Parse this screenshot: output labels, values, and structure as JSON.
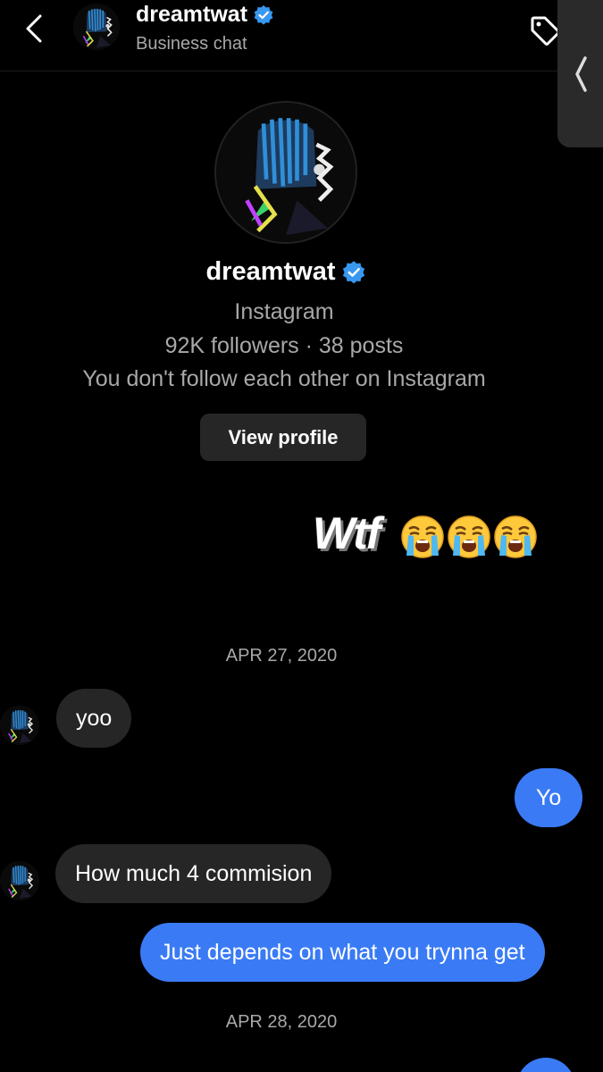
{
  "header": {
    "username": "dreamtwat",
    "subtitle": "Business chat"
  },
  "profile": {
    "username": "dreamtwat",
    "platform": "Instagram",
    "stats": "92K followers · 38 posts",
    "relation": "You don't follow each other on Instagram",
    "view_profile_label": "View profile"
  },
  "overlay": {
    "text": "Wtf",
    "emoji_icons": [
      "loudly-crying-face-icon",
      "loudly-crying-face-icon",
      "loudly-crying-face-icon"
    ]
  },
  "thread": {
    "date_1": "APR 27, 2020",
    "date_2": "APR 28, 2020",
    "messages": [
      {
        "from": "them",
        "text": "yoo"
      },
      {
        "from": "me",
        "text": "Yo"
      },
      {
        "from": "them",
        "text": "How much 4 commision"
      },
      {
        "from": "me",
        "text": "Just depends on what you trynna get"
      }
    ]
  },
  "colors": {
    "background": "#000000",
    "incoming_bubble": "#262626",
    "outgoing_bubble": "#3a7bf5",
    "verified_badge": "#3897f0",
    "muted_text": "#a8a8a8"
  }
}
